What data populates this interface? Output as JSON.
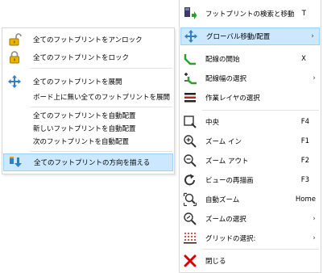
{
  "submenu": {
    "items": [
      {
        "label": "全てのフットプリントをアンロック",
        "icon": "unlock-icon"
      },
      {
        "label": "全てのフットプリントをロック",
        "icon": "lock-icon"
      },
      {
        "label": "全てのフットプリントを展開",
        "icon": "move-cross-icon"
      },
      {
        "label": "ボード上に無い全てのフットプリントを展開"
      },
      {
        "label": "全てのフットプリントを自動配置"
      },
      {
        "label": "新しいフットプリントを自動配置"
      },
      {
        "label": "次のフットプリントを自動配置"
      },
      {
        "label": "全てのフットプリントの方向を揃える",
        "icon": "orient-footprints-icon",
        "selected": true
      }
    ]
  },
  "mainmenu": {
    "items": [
      {
        "label": "フットプリントの検索と移動",
        "shortcut": "T",
        "icon": "find-move-icon"
      },
      {
        "label": "グローバル移動/配置",
        "submenu": true,
        "icon": "move-cross-icon",
        "selected": true
      },
      {
        "label": "配線の開始",
        "shortcut": "X",
        "icon": "route-track-icon"
      },
      {
        "label": "配線幅の選択",
        "submenu": true,
        "icon": "track-width-icon"
      },
      {
        "label": "作業レイヤの選択",
        "icon": "layers-icon"
      },
      {
        "label": "中央",
        "shortcut": "F4",
        "icon": "zoom-center-icon"
      },
      {
        "label": "ズーム イン",
        "shortcut": "F1",
        "icon": "zoom-in-icon"
      },
      {
        "label": "ズーム アウト",
        "shortcut": "F2",
        "icon": "zoom-out-icon"
      },
      {
        "label": "ビューの再描画",
        "shortcut": "F3",
        "icon": "redraw-icon"
      },
      {
        "label": "自動ズーム",
        "shortcut": "Home",
        "icon": "zoom-auto-icon"
      },
      {
        "label": "ズームの選択",
        "submenu": true,
        "icon": "zoom-select-icon"
      },
      {
        "label": "グリッドの選択:",
        "submenu": true,
        "icon": "grid-icon"
      },
      {
        "label": "閉じる",
        "icon": "close-icon"
      }
    ],
    "submenu_arrow": "›"
  },
  "colors": {
    "highlight": "#cce8ff",
    "highlight_border": "#99d1ff",
    "close_red": "#d80000",
    "route_green": "#2aa02a"
  }
}
